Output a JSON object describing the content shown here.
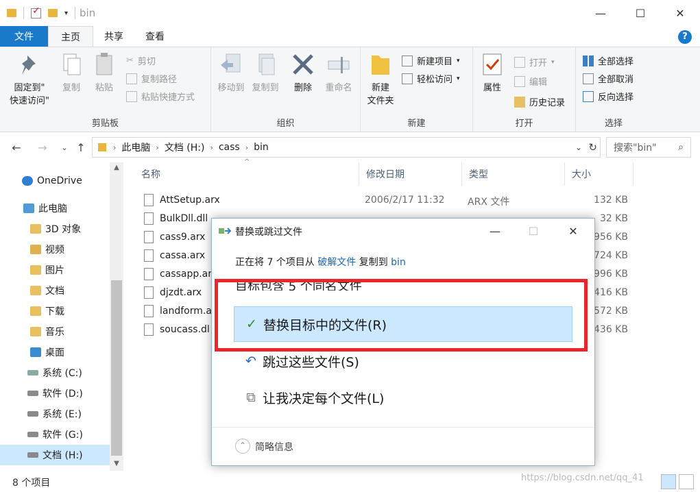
{
  "window": {
    "title": "bin"
  },
  "ribbon_tabs": [
    "文件",
    "主页",
    "共享",
    "查看"
  ],
  "ribbon": {
    "clipboard": {
      "pin_label_1": "固定到\"",
      "pin_label_2": "快速访问\"",
      "copy": "复制",
      "paste": "粘贴",
      "cut": "剪切",
      "copy_path": "复制路径",
      "paste_shortcut": "粘贴快捷方式",
      "group": "剪贴板"
    },
    "organize": {
      "move_to": "移动到",
      "copy_to": "复制到",
      "delete": "删除",
      "rename": "重命名",
      "group": "组织"
    },
    "new": {
      "new_folder_1": "新建",
      "new_folder_2": "文件夹",
      "new_item": "新建项目",
      "easy_access": "轻松访问",
      "group": "新建"
    },
    "open": {
      "properties": "属性",
      "open": "打开",
      "edit": "编辑",
      "history": "历史记录",
      "group": "打开"
    },
    "select": {
      "select_all": "全部选择",
      "select_none": "全部取消",
      "invert": "反向选择",
      "group": "选择"
    }
  },
  "address": {
    "crumbs": [
      "此电脑",
      "文档 (H:)",
      "cass",
      "bin"
    ],
    "search_placeholder": "搜索\"bin\""
  },
  "nav": {
    "items": [
      "OneDrive",
      "此电脑",
      "3D 对象",
      "视频",
      "图片",
      "文档",
      "下载",
      "音乐",
      "桌面",
      "系统 (C:)",
      "软件 (D:)",
      "系统 (E:)",
      "软件 (G:)",
      "文档 (H:)"
    ]
  },
  "columns": [
    "名称",
    "修改日期",
    "类型",
    "大小"
  ],
  "files": [
    {
      "name": "AttSetup.arx",
      "date": "2006/2/17 11:32",
      "type": "ARX 文件",
      "size": "132 KB"
    },
    {
      "name": "BulkDll.dll",
      "date": "",
      "type": "",
      "size": "32 KB"
    },
    {
      "name": "cass9.arx",
      "date": "",
      "type": "",
      "size": "956 KB"
    },
    {
      "name": "cassa.arx",
      "date": "",
      "type": "",
      "size": "724 KB"
    },
    {
      "name": "cassapp.ar",
      "date": "",
      "type": "",
      "size": "996 KB"
    },
    {
      "name": "djzdt.arx",
      "date": "",
      "type": "",
      "size": "416 KB"
    },
    {
      "name": "landform.a",
      "date": "",
      "type": "",
      "size": "572 KB"
    },
    {
      "name": "soucass.dl",
      "date": "",
      "type": "",
      "size": "436 KB"
    }
  ],
  "status": {
    "count": "8 个项目"
  },
  "watermark": "https://blog.csdn.net/qq_41",
  "dialog": {
    "title": "替换或跳过文件",
    "line_prefix": "正在将 7 个项目从 ",
    "from": "破解文件",
    "mid": " 复制到 ",
    "to": "bin",
    "heading": "目标包含 5 个同名文件",
    "options": [
      "替换目标中的文件(R)",
      "跳过这些文件(S)",
      "让我决定每个文件(L)"
    ],
    "footer": "简略信息"
  },
  "colors": {
    "accent": "#1979ca",
    "selection": "#cce8ff",
    "highlight_box": "#e8262b",
    "link": "#1a67b8"
  }
}
